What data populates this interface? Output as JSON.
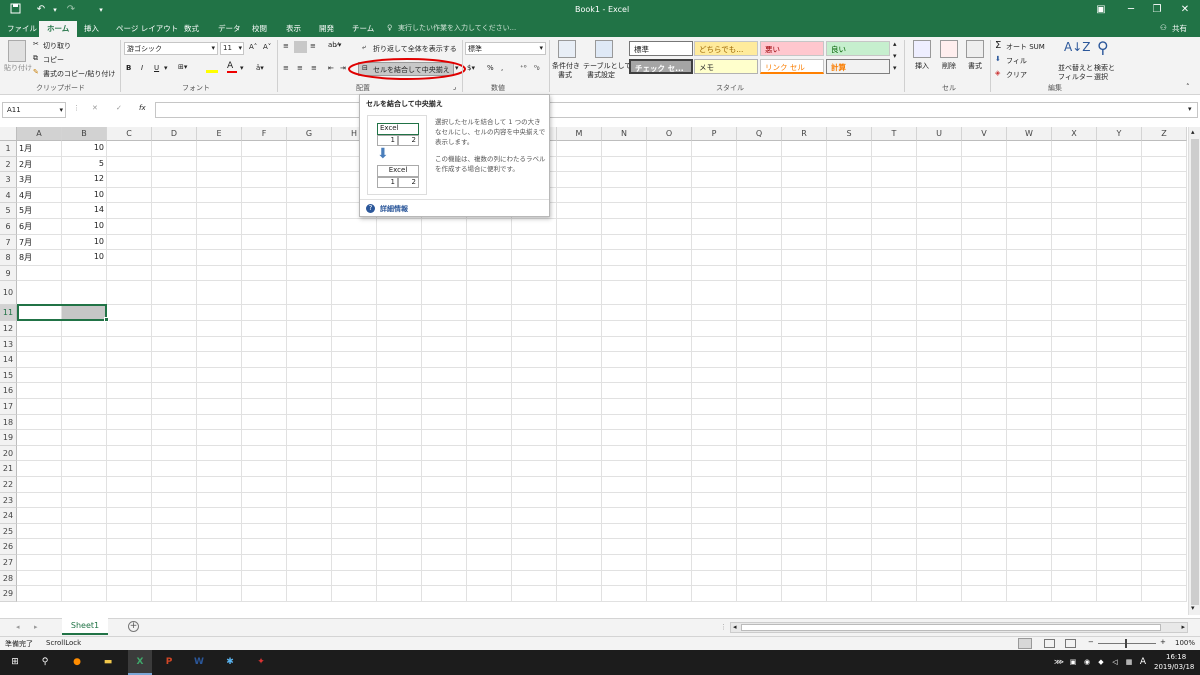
{
  "titlebar": {
    "title": "Book1 - Excel"
  },
  "tabs": {
    "file": "ファイル",
    "home": "ホーム",
    "insert": "挿入",
    "layout": "ページ レイアウト",
    "formulas": "数式",
    "data": "データ",
    "review": "校閲",
    "view": "表示",
    "developer": "開発",
    "team": "チーム",
    "tellme": "実行したい作業を入力してください...",
    "share": "共有"
  },
  "ribbon": {
    "clipboard": {
      "paste": "貼り付け",
      "cut": "切り取り",
      "copy": "コピー",
      "format_painter": "書式のコピー/貼り付け",
      "label": "クリップボード"
    },
    "font": {
      "name": "游ゴシック",
      "size": "11",
      "bold": "B",
      "italic": "I",
      "underline": "U",
      "label": "フォント"
    },
    "alignment": {
      "wrap": "折り返して全体を表示する",
      "merge": "セルを結合して中央揃え",
      "label": "配置"
    },
    "number": {
      "format": "標準",
      "percent": "%",
      "comma": ",",
      "label": "数値"
    },
    "styles": {
      "conditional": "条件付き",
      "conditional2": "書式",
      "table": "テーブルとして",
      "table2": "書式設定",
      "cells": [
        "標準",
        "どちらでも...",
        "悪い",
        "良い",
        "チェック セ...",
        "メモ",
        "リンク セル",
        "計算"
      ],
      "label": "スタイル"
    },
    "cells": {
      "insert": "挿入",
      "delete": "削除",
      "format": "書式",
      "label": "セル"
    },
    "editing": {
      "autosum": "オート SUM",
      "fill": "フィル",
      "clear": "クリア",
      "sort": "並べ替えと",
      "sort2": "フィルター",
      "find": "検索と",
      "find2": "選択",
      "label": "編集"
    }
  },
  "formulabar": {
    "namebox": "A11",
    "fx": "fx"
  },
  "columns": [
    "A",
    "B",
    "C",
    "D",
    "E",
    "F",
    "G",
    "H",
    "I",
    "J",
    "K",
    "L",
    "M",
    "N",
    "O",
    "P",
    "Q",
    "R",
    "S",
    "T",
    "U",
    "V",
    "W",
    "X",
    "Y",
    "Z"
  ],
  "rows": [
    "1",
    "2",
    "3",
    "4",
    "5",
    "6",
    "7",
    "8",
    "9",
    "10",
    "11",
    "12",
    "13",
    "14",
    "15",
    "16",
    "17",
    "18",
    "19",
    "20",
    "21",
    "22",
    "23",
    "24",
    "25",
    "26",
    "27",
    "28",
    "29"
  ],
  "data": [
    {
      "a": "1月",
      "b": "10"
    },
    {
      "a": "2月",
      "b": "5"
    },
    {
      "a": "3月",
      "b": "12"
    },
    {
      "a": "4月",
      "b": "10"
    },
    {
      "a": "5月",
      "b": "14"
    },
    {
      "a": "6月",
      "b": "10"
    },
    {
      "a": "7月",
      "b": "10"
    },
    {
      "a": "8月",
      "b": "10"
    }
  ],
  "tooltip": {
    "title": "セルを結合して中央揃え",
    "desc1": "選択したセルを結合して 1 つの大き",
    "desc2": "なセルにし、セルの内容を中央揃えで",
    "desc3": "表示します。",
    "desc4": "この機能は、複数の列にわたるラベル",
    "desc5": "を作成する場合に便利です。",
    "ex_label": "Excel",
    "ex_1": "1",
    "ex_2": "2",
    "more": "詳細情報"
  },
  "sheets": {
    "active": "Sheet1"
  },
  "status": {
    "ready": "準備完了",
    "scroll": "ScrollLock",
    "zoom": "100%"
  },
  "taskbar": {
    "time": "16:18",
    "date": "2019/03/18"
  }
}
